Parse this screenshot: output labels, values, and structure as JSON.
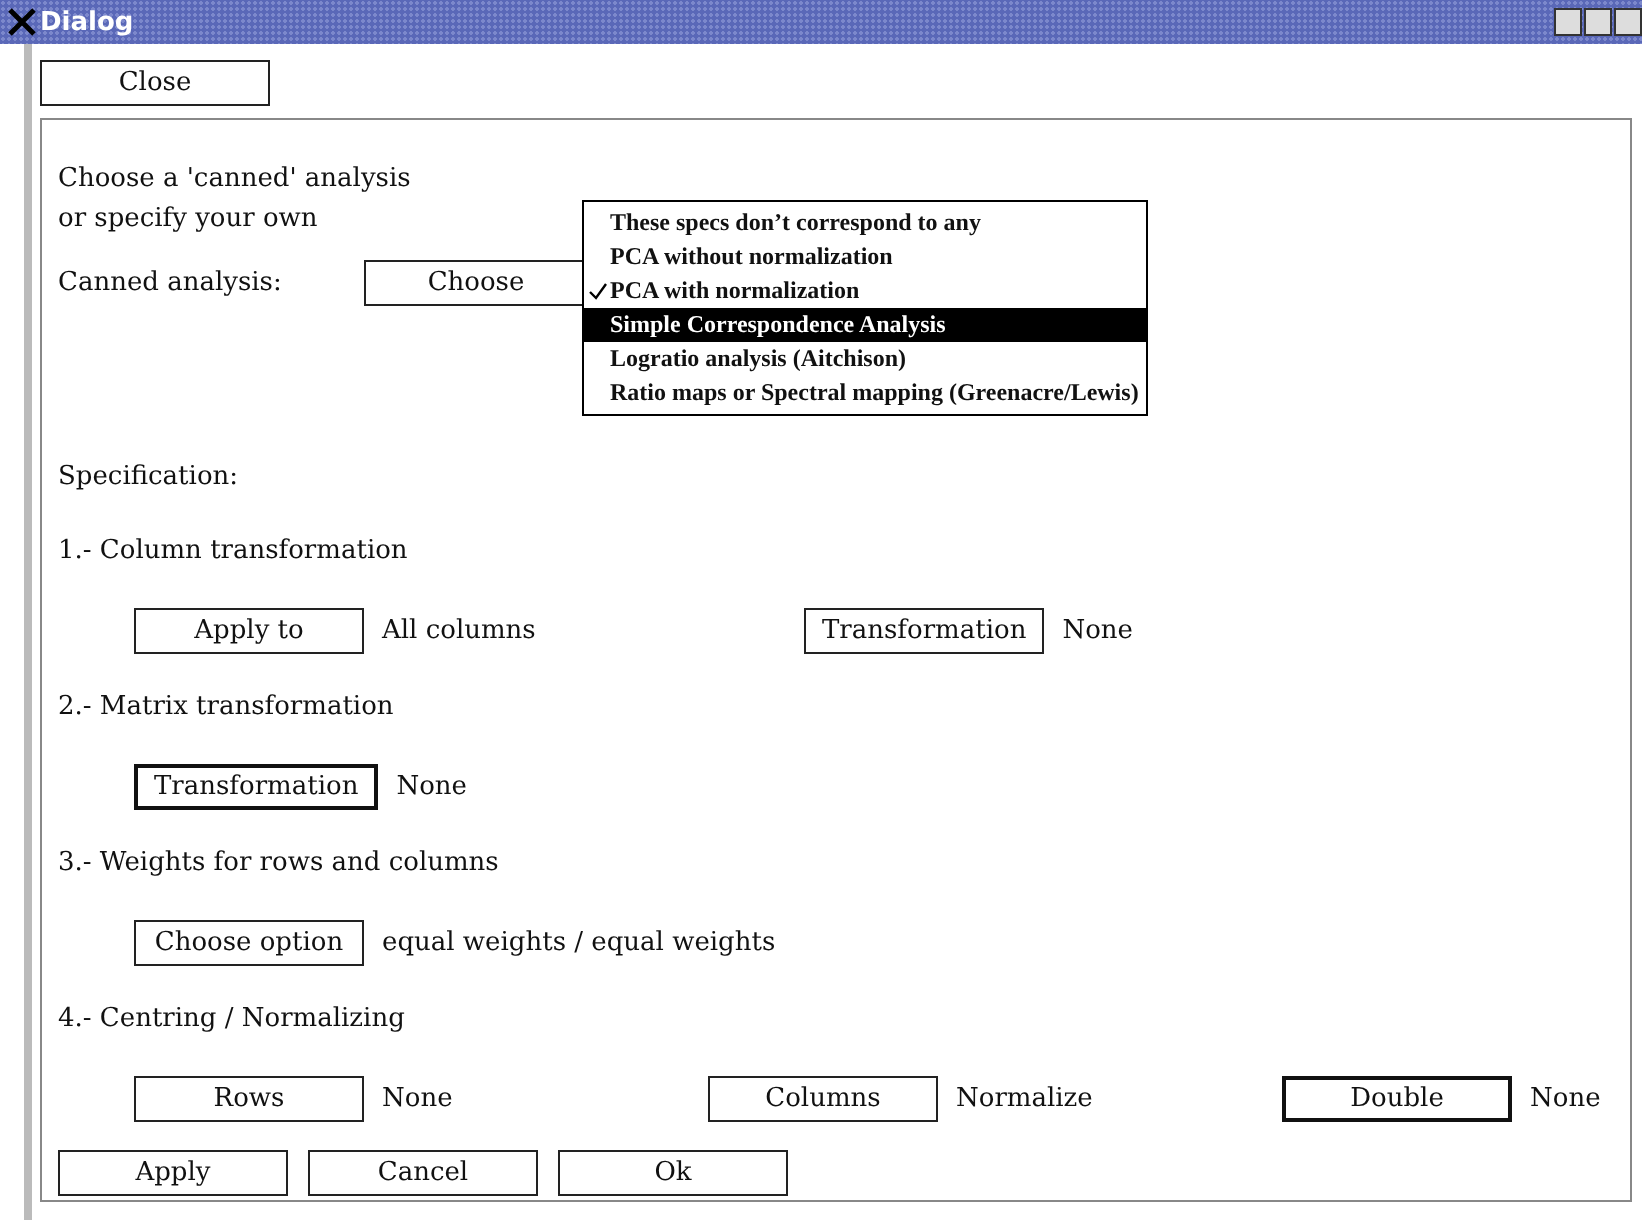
{
  "window": {
    "title": "Dialog"
  },
  "close_button": "Close",
  "intro": [
    "Choose a 'canned' analysis",
    "or specify your own"
  ],
  "canned": {
    "label": "Canned analysis:",
    "button": "Choose"
  },
  "menu": [
    {
      "label": "These specs don’t correspond to any",
      "checked": false,
      "selected": false
    },
    {
      "label": "PCA without normalization",
      "checked": false,
      "selected": false
    },
    {
      "label": "PCA with normalization",
      "checked": true,
      "selected": false
    },
    {
      "label": "Simple Correspondence Analysis",
      "checked": false,
      "selected": true
    },
    {
      "label": "Logratio analysis (Aitchison)",
      "checked": false,
      "selected": false
    },
    {
      "label": "Ratio maps or Spectral mapping (Greenacre/Lewis)",
      "checked": false,
      "selected": false
    }
  ],
  "specification_label": "Specification:",
  "sections": [
    {
      "title": "1.- Column transformation",
      "groups": [
        {
          "button": "Apply to",
          "focused": false,
          "value": "All columns"
        },
        {
          "button": "Transformation",
          "focused": false,
          "value": "None"
        }
      ]
    },
    {
      "title": "2.- Matrix transformation",
      "groups": [
        {
          "button": "Transformation",
          "focused": true,
          "value": "None"
        }
      ]
    },
    {
      "title": "3.- Weights for rows and columns",
      "groups": [
        {
          "button": "Choose option",
          "focused": false,
          "value": "equal weights / equal weights"
        }
      ]
    },
    {
      "title": "4.- Centring / Normalizing",
      "groups": [
        {
          "button": "Rows",
          "focused": false,
          "value": "None"
        },
        {
          "button": "Columns",
          "focused": false,
          "value": "Normalize"
        },
        {
          "button": "Double",
          "focused": true,
          "value": "None"
        }
      ]
    }
  ],
  "footer_buttons": [
    "Apply",
    "Cancel",
    "Ok"
  ]
}
